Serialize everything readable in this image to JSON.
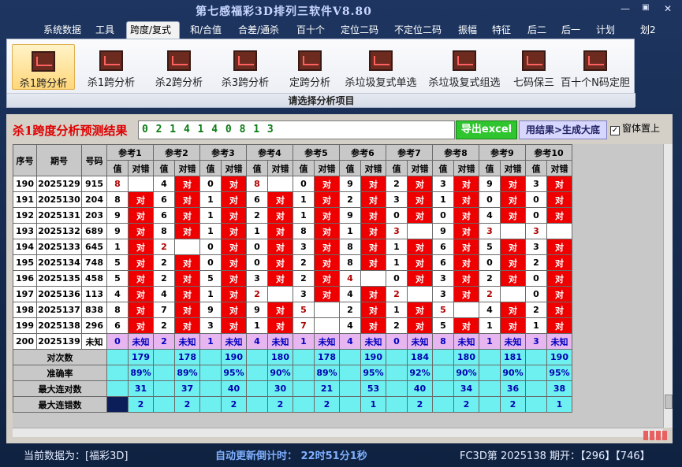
{
  "app": {
    "title": "第七感福彩3D排列三软件V8.80"
  },
  "window": {
    "minimize": "—",
    "restore": "▣",
    "close": "✕"
  },
  "menu": [
    "系统数据",
    "工具",
    "跨度/复式",
    "和/合值",
    "合差/通杀",
    "百十个",
    "定位二码",
    "不定位二码",
    "振幅",
    "特征",
    "后二",
    "后一",
    "计划",
    "划2"
  ],
  "ribbon": {
    "items": [
      "杀1跨分析",
      "杀1跨分析",
      "杀2跨分析",
      "杀3跨分析",
      "定跨分析",
      "杀垃圾复式单选",
      "杀垃圾复式组选",
      "七码保三",
      "百十个N码定胆"
    ],
    "caption": "请选择分析项目"
  },
  "result": {
    "title": "杀1跨度分析预测结果",
    "value": "0 2 1 4 1 4 0 8 1 3",
    "excel_btn": "导出excel",
    "gen_btn": "用结果>生成大底",
    "checkbox_label": "窗体置上",
    "checkbox_mark": "✓"
  },
  "table": {
    "headers": {
      "seq": "序号",
      "period": "期号",
      "code": "号码"
    },
    "ref_labels": [
      "参考1",
      "参考2",
      "参考3",
      "参考4",
      "参考5",
      "参考6",
      "参考7",
      "参考8",
      "参考9",
      "参考10"
    ],
    "sub_value": "值",
    "sub_result": "对错",
    "hit_text": "对",
    "rows": [
      {
        "seq": "190",
        "period": "2025129",
        "code": "915",
        "vals": [
          "8",
          "4",
          "0",
          "8",
          "0",
          "9",
          "2",
          "3",
          "9",
          "3"
        ],
        "res": [
          0,
          1,
          1,
          0,
          1,
          1,
          1,
          1,
          1,
          1
        ]
      },
      {
        "seq": "191",
        "period": "2025130",
        "code": "204",
        "vals": [
          "8",
          "6",
          "1",
          "6",
          "1",
          "2",
          "3",
          "1",
          "0",
          "0"
        ],
        "res": [
          1,
          1,
          1,
          1,
          1,
          1,
          1,
          1,
          1,
          1
        ]
      },
      {
        "seq": "192",
        "period": "2025131",
        "code": "203",
        "vals": [
          "9",
          "6",
          "1",
          "2",
          "1",
          "9",
          "0",
          "0",
          "4",
          "0"
        ],
        "res": [
          1,
          1,
          1,
          1,
          1,
          1,
          1,
          1,
          1,
          1
        ]
      },
      {
        "seq": "193",
        "period": "2025132",
        "code": "689",
        "vals": [
          "9",
          "8",
          "1",
          "1",
          "8",
          "1",
          "3",
          "9",
          "3",
          "3"
        ],
        "res": [
          1,
          1,
          1,
          1,
          1,
          1,
          0,
          1,
          0,
          0
        ]
      },
      {
        "seq": "194",
        "period": "2025133",
        "code": "645",
        "vals": [
          "1",
          "2",
          "0",
          "0",
          "3",
          "8",
          "1",
          "6",
          "5",
          "3"
        ],
        "res": [
          1,
          0,
          1,
          1,
          1,
          1,
          1,
          1,
          1,
          1
        ]
      },
      {
        "seq": "195",
        "period": "2025134",
        "code": "748",
        "vals": [
          "5",
          "2",
          "0",
          "0",
          "2",
          "8",
          "1",
          "6",
          "0",
          "2"
        ],
        "res": [
          1,
          1,
          1,
          1,
          1,
          1,
          1,
          1,
          1,
          1
        ]
      },
      {
        "seq": "196",
        "period": "2025135",
        "code": "458",
        "vals": [
          "5",
          "2",
          "5",
          "3",
          "2",
          "4",
          "0",
          "3",
          "2",
          "0"
        ],
        "res": [
          1,
          1,
          1,
          1,
          1,
          0,
          1,
          1,
          1,
          1
        ]
      },
      {
        "seq": "197",
        "period": "2025136",
        "code": "113",
        "vals": [
          "4",
          "4",
          "1",
          "2",
          "3",
          "4",
          "2",
          "3",
          "2",
          "0"
        ],
        "res": [
          1,
          1,
          1,
          0,
          1,
          1,
          0,
          1,
          0,
          1
        ]
      },
      {
        "seq": "198",
        "period": "2025137",
        "code": "838",
        "vals": [
          "8",
          "7",
          "9",
          "9",
          "5",
          "2",
          "1",
          "5",
          "4",
          "2"
        ],
        "res": [
          1,
          1,
          1,
          1,
          0,
          1,
          1,
          0,
          1,
          1
        ]
      },
      {
        "seq": "199",
        "period": "2025138",
        "code": "296",
        "vals": [
          "6",
          "2",
          "3",
          "1",
          "7",
          "4",
          "2",
          "5",
          "1",
          "1"
        ],
        "res": [
          1,
          1,
          1,
          1,
          0,
          1,
          1,
          1,
          1,
          1
        ]
      }
    ],
    "unknown_row": {
      "seq": "200",
      "period": "2025139",
      "code": "未知",
      "vals": [
        "0",
        "2",
        "1",
        "4",
        "1",
        "4",
        "0",
        "8",
        "1",
        "3"
      ],
      "res_text": "未知"
    },
    "stats": [
      {
        "label": "对次数",
        "vals": [
          "179",
          "178",
          "190",
          "180",
          "178",
          "190",
          "184",
          "180",
          "181",
          "190"
        ]
      },
      {
        "label": "准确率",
        "vals": [
          "89%",
          "89%",
          "95%",
          "90%",
          "89%",
          "95%",
          "92%",
          "90%",
          "90%",
          "95%"
        ]
      },
      {
        "label": "最大连对数",
        "vals": [
          "31",
          "37",
          "40",
          "30",
          "21",
          "53",
          "40",
          "34",
          "36",
          "38"
        ]
      },
      {
        "label": "最大连错数",
        "vals": [
          "2",
          "2",
          "2",
          "2",
          "2",
          "1",
          "2",
          "2",
          "2",
          "1"
        ]
      }
    ]
  },
  "status": {
    "left": "当前数据为：[福彩3D]",
    "mid": "自动更新倒计时：  22时51分1秒",
    "right": "FC3D第 2025138 期开：【296】【746】"
  },
  "colors": {
    "hit": "#ee0000",
    "unknown": "#e7b6f0",
    "stats": "#6ef0f0",
    "result_text": "#0a7a14"
  }
}
